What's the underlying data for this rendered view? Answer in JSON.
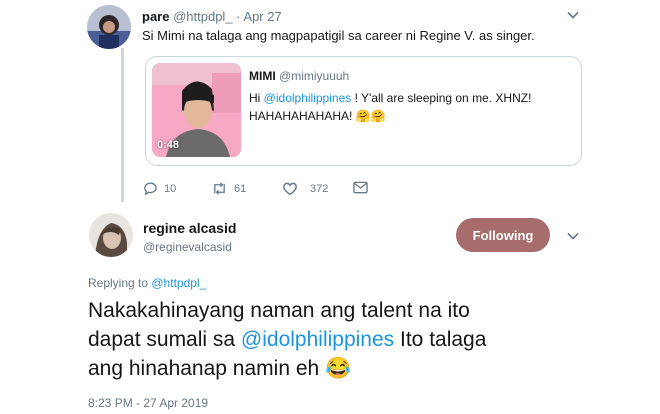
{
  "tweet1": {
    "name": "pare",
    "handle": "@httpdpl_",
    "sep": " · ",
    "date": "Apr 27",
    "text": "Si Mimi na talaga ang magpapatigil sa career ni Regine V. as singer."
  },
  "quoted": {
    "name": "MIMI",
    "handle": "@mimiyuuuh",
    "text_pre": "Hi ",
    "mention": "@idolphilippines",
    "text_line1_post": " ! Y'all are sleeping on me. XHNZ!",
    "text_line2": "HAHAHAHAHAHA! 🤗🤗",
    "video_duration": "0:48"
  },
  "actions": {
    "replies": "10",
    "retweets": "61",
    "likes": "372"
  },
  "tweet2": {
    "name": "regine alcasid",
    "handle": "@reginevalcasid",
    "follow_label": "Following",
    "replying_prefix": "Replying to ",
    "replying_handle": "@httpdpl_",
    "text_line1": "Nakakahinayang naman ang talent na ito",
    "text_line2_pre": "dapat sumali sa ",
    "text_line2_mention": "@idolphilippines",
    "text_line2_post": " Ito talaga",
    "text_line3": "ang hinahanap namin eh 😂",
    "timestamp": "8:23 PM - 27 Apr 2019"
  },
  "colors": {
    "link": "#1b95e0",
    "muted": "#657786",
    "follow_button": "#a76d6d"
  }
}
